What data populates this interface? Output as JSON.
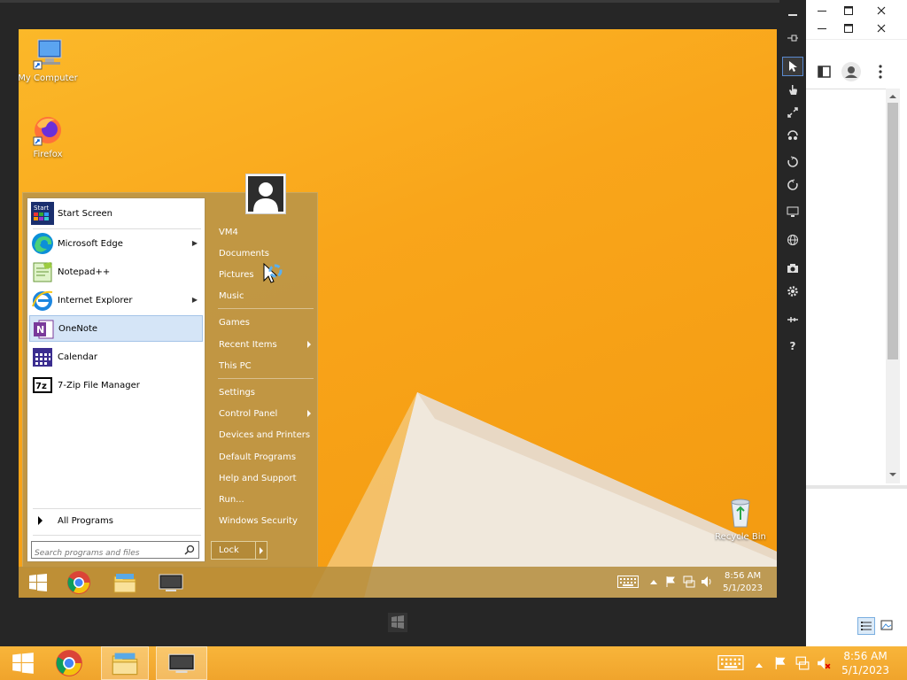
{
  "desktop": {
    "icons": [
      {
        "label": "My Computer"
      },
      {
        "label": "Firefox"
      },
      {
        "label": "Recycle Bin"
      }
    ]
  },
  "start_menu": {
    "pinned": [
      {
        "label": "Start Screen"
      },
      {
        "label": "Microsoft Edge"
      },
      {
        "label": "Notepad++"
      },
      {
        "label": "Internet Explorer"
      },
      {
        "label": "OneNote"
      },
      {
        "label": "Calendar"
      },
      {
        "label": "7-Zip File Manager"
      }
    ],
    "start_tile_text": "Start",
    "all_programs": "All Programs",
    "search_placeholder": "Search programs and files",
    "right_items": [
      {
        "label": "VM4"
      },
      {
        "label": "Documents"
      },
      {
        "label": "Pictures"
      },
      {
        "label": "Music"
      },
      {
        "label": "Games"
      },
      {
        "label": "Recent Items"
      },
      {
        "label": "This PC"
      },
      {
        "label": "Settings"
      },
      {
        "label": "Control Panel"
      },
      {
        "label": "Devices and Printers"
      },
      {
        "label": "Default Programs"
      },
      {
        "label": "Help and Support"
      },
      {
        "label": "Run..."
      },
      {
        "label": "Windows Security"
      }
    ],
    "lock_label": "Lock",
    "onenote_tile_text": "N",
    "zip_tile_text": "7z"
  },
  "vm_taskbar": {
    "time": "8:56 AM",
    "date": "5/1/2023"
  },
  "host_taskbar": {
    "time": "8:56 AM",
    "date": "5/1/2023"
  },
  "side_toolbar": {
    "help_label": "?"
  },
  "colors": {
    "accent_orange": "#f9a51a",
    "selection": "#d5e5f7"
  }
}
